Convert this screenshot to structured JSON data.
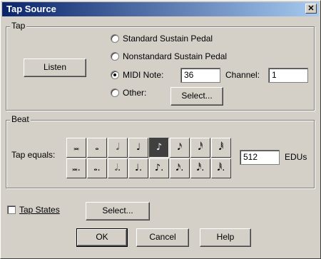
{
  "window": {
    "title": "Tap Source",
    "close_glyph": "✕"
  },
  "tap": {
    "group_label": "Tap",
    "listen_label": "Listen",
    "options": [
      {
        "label": "Standard Sustain Pedal",
        "selected": false
      },
      {
        "label": "Nonstandard Sustain Pedal",
        "selected": false
      },
      {
        "label": "MIDI Note:",
        "selected": true
      },
      {
        "label": "Other:",
        "selected": false
      }
    ],
    "midi_note_value": "36",
    "channel_label": "Channel:",
    "channel_value": "1",
    "select_label": "Select..."
  },
  "beat": {
    "group_label": "Beat",
    "tap_equals_label": "Tap equals:",
    "row1": [
      {
        "icon": "double-whole-note-icon",
        "glyph": "𝅜"
      },
      {
        "icon": "whole-note-icon",
        "glyph": "𝅝"
      },
      {
        "icon": "half-note-icon",
        "glyph": "𝅗𝅥"
      },
      {
        "icon": "quarter-note-icon",
        "glyph": "♩"
      },
      {
        "icon": "eighth-note-icon",
        "glyph": "♪",
        "selected": true
      },
      {
        "icon": "sixteenth-note-icon",
        "glyph": "𝅘𝅥𝅯"
      },
      {
        "icon": "thirty-second-note-icon",
        "glyph": "𝅘𝅥𝅰"
      },
      {
        "icon": "sixty-fourth-note-icon",
        "glyph": "𝅘𝅥𝅱"
      }
    ],
    "row2": [
      {
        "icon": "dotted-double-whole-note-icon",
        "glyph": "𝅜."
      },
      {
        "icon": "dotted-whole-note-icon",
        "glyph": "𝅝."
      },
      {
        "icon": "dotted-half-note-icon",
        "glyph": "𝅗𝅥."
      },
      {
        "icon": "dotted-quarter-note-icon",
        "glyph": "♩."
      },
      {
        "icon": "dotted-eighth-note-icon",
        "glyph": "♪."
      },
      {
        "icon": "dotted-sixteenth-note-icon",
        "glyph": "𝅘𝅥𝅯."
      },
      {
        "icon": "dotted-thirty-second-note-icon",
        "glyph": "𝅘𝅥𝅰."
      },
      {
        "icon": "dotted-sixty-fourth-note-icon",
        "glyph": "𝅘𝅥𝅱."
      }
    ],
    "edu_value": "512",
    "edu_label": "EDUs"
  },
  "tap_states": {
    "label": "Tap States",
    "checked": false,
    "select_label": "Select..."
  },
  "footer": {
    "ok_label": "OK",
    "cancel_label": "Cancel",
    "help_label": "Help"
  }
}
